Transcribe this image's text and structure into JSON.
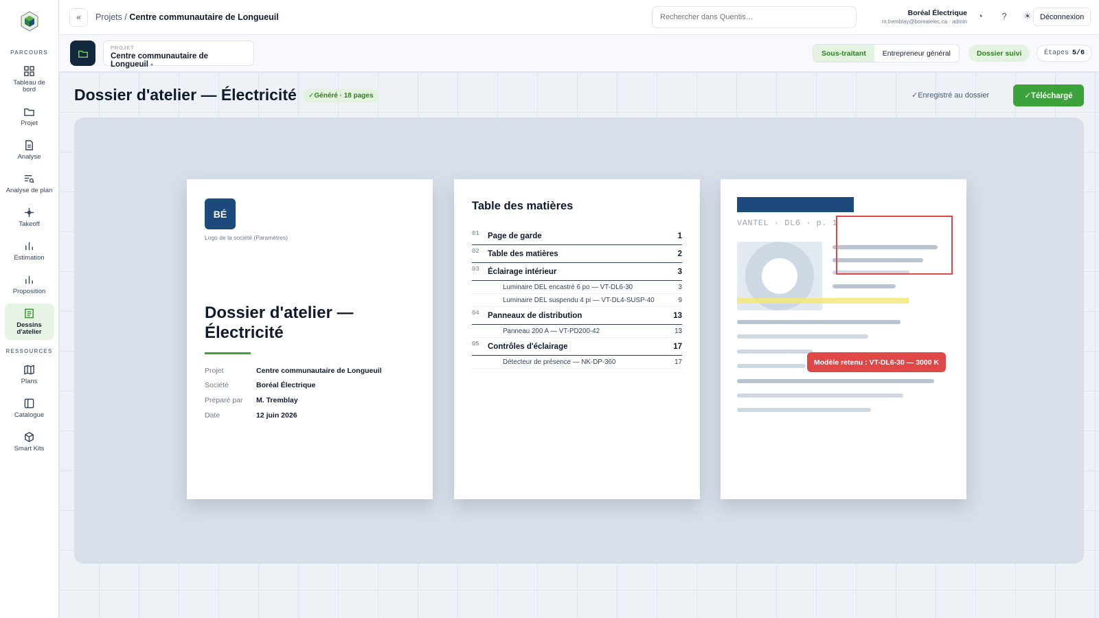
{
  "sidebar": {
    "section_parcours": "PARCOURS",
    "section_ressources": "RESSOURCES",
    "parcours": [
      {
        "label": "Tableau de bord",
        "icon": "grid-icon"
      },
      {
        "label": "Projet",
        "icon": "folder-icon"
      },
      {
        "label": "Analyse",
        "icon": "document-icon"
      },
      {
        "label": "Analyse de plan",
        "icon": "plan-analysis-icon"
      },
      {
        "label": "Takeoff",
        "icon": "crosshair-icon"
      },
      {
        "label": "Estimation",
        "icon": "bar-chart-icon"
      },
      {
        "label": "Proposition",
        "icon": "bar-chart-icon"
      },
      {
        "label": "Dessins d'atelier",
        "icon": "drawing-icon",
        "active": true
      }
    ],
    "ressources": [
      {
        "label": "Plans",
        "icon": "map-icon"
      },
      {
        "label": "Catalogue",
        "icon": "book-icon"
      },
      {
        "label": "Smart Kits",
        "icon": "cube-icon"
      }
    ]
  },
  "header": {
    "collapse_label": "«",
    "breadcrumb_root": "Projets",
    "breadcrumb_sep": " / ",
    "breadcrumb_current": "Centre communautaire de Longueuil",
    "search_placeholder": "Rechercher dans Quentis…",
    "user_name": "Boréal Électrique",
    "user_sub": "m.tremblay@borealelec.ca · admin",
    "logout_label": "Déconnexion"
  },
  "project_bar": {
    "project_caption": "PROJET",
    "project_name": "Centre communautaire de Longueuil",
    "roles": [
      "Sous-traitant",
      "Entrepreneur général"
    ],
    "active_role": "Sous-traitant",
    "status_pill": "Dossier suivi",
    "steps_label": "Étapes",
    "steps_value": "5/6"
  },
  "main": {
    "title": "Dossier d'atelier — Électricité",
    "generated_badge": "✓Généré · 18 pages",
    "saved_label": "✓Enregistré au dossier",
    "download_label": "✓Téléchargé"
  },
  "cover": {
    "logo_text": "BÉ",
    "logo_caption": "Logo de la société (Paramètres)",
    "title": "Dossier d'atelier — Électricité",
    "meta": [
      {
        "k": "Projet",
        "v": "Centre communautaire de Longueuil"
      },
      {
        "k": "Société",
        "v": "Boréal Électrique"
      },
      {
        "k": "Préparé par",
        "v": "M. Tremblay"
      },
      {
        "k": "Date",
        "v": "12 juin 2026"
      }
    ]
  },
  "toc": {
    "title": "Table des matières",
    "sections": [
      {
        "num": "01",
        "label": "Page de garde",
        "page": "1",
        "subs": []
      },
      {
        "num": "02",
        "label": "Table des matières",
        "page": "2",
        "subs": []
      },
      {
        "num": "03",
        "label": "Éclairage intérieur",
        "page": "3",
        "subs": [
          {
            "label": "Luminaire DEL encastré 6 po — VT-DL6-30",
            "page": "3"
          },
          {
            "label": "Luminaire DEL suspendu 4 pi — VT-DL4-SUSP-40",
            "page": "9"
          }
        ]
      },
      {
        "num": "04",
        "label": "Panneaux de distribution",
        "page": "13",
        "subs": [
          {
            "label": "Panneau 200 A — VT-PD200-42",
            "page": "13"
          }
        ]
      },
      {
        "num": "05",
        "label": "Contrôles d'éclairage",
        "page": "17",
        "subs": [
          {
            "label": "Détecteur de présence — NK-DP-360",
            "page": "17"
          }
        ]
      }
    ]
  },
  "product_page": {
    "code": "VANTEL · DL6 · p. 1",
    "selected_tag": "Modèle retenu : VT-DL6-30 — 3000 K"
  },
  "colors": {
    "accent_green": "#3ba33a",
    "navy": "#1d4a7c",
    "highlight_red": "#e04848"
  }
}
